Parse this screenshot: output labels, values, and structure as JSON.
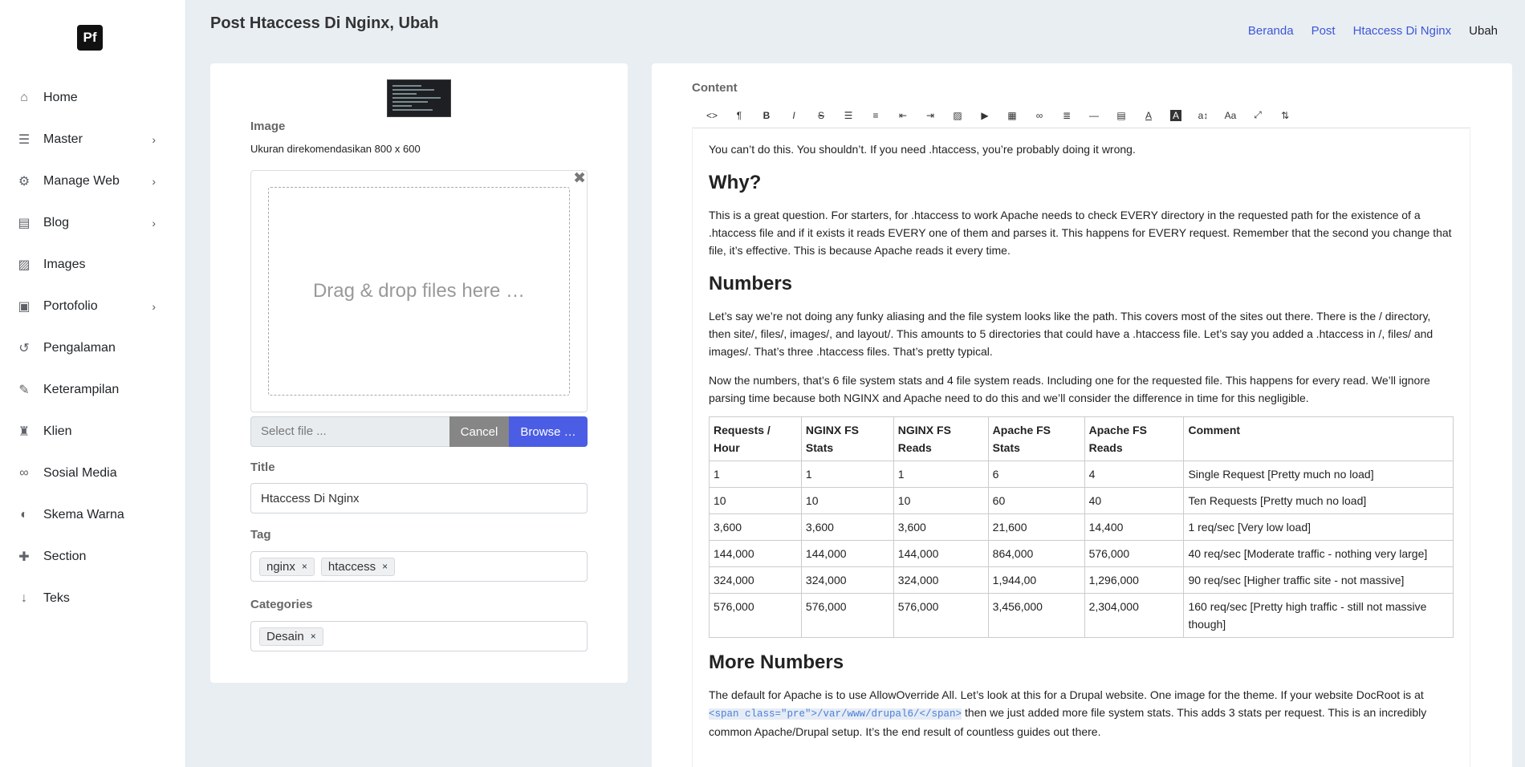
{
  "logo": "Pf",
  "sidebar": {
    "items": [
      {
        "label": "Home",
        "icon": "home-icon",
        "glyph": "⌂",
        "chevron": false
      },
      {
        "label": "Master",
        "icon": "database-icon",
        "glyph": "☰",
        "chevron": true
      },
      {
        "label": "Manage Web",
        "icon": "gears-icon",
        "glyph": "⚙",
        "chevron": true
      },
      {
        "label": "Blog",
        "icon": "newspaper-icon",
        "glyph": "▤",
        "chevron": true
      },
      {
        "label": "Images",
        "icon": "image-icon",
        "glyph": "▨",
        "chevron": false
      },
      {
        "label": "Portofolio",
        "icon": "archive-icon",
        "glyph": "▣",
        "chevron": true
      },
      {
        "label": "Pengalaman",
        "icon": "history-icon",
        "glyph": "↺",
        "chevron": false
      },
      {
        "label": "Keterampilan",
        "icon": "tools-icon",
        "glyph": "✎",
        "chevron": false
      },
      {
        "label": "Klien",
        "icon": "users-icon",
        "glyph": "♜",
        "chevron": false
      },
      {
        "label": "Sosial Media",
        "icon": "link-icon",
        "glyph": "∞",
        "chevron": false
      },
      {
        "label": "Skema Warna",
        "icon": "contrast-icon",
        "glyph": "◐",
        "chevron": false
      },
      {
        "label": "Section",
        "icon": "puzzle-icon",
        "glyph": "✚",
        "chevron": false
      },
      {
        "label": "Teks",
        "icon": "sort-alpha-icon",
        "glyph": "↓",
        "chevron": false
      }
    ],
    "chevron_glyph": "›"
  },
  "header": {
    "title": "Post Htaccess Di Nginx, Ubah",
    "breadcrumbs": [
      "Beranda",
      "Post",
      "Htaccess Di Nginx"
    ],
    "current": "Ubah"
  },
  "form": {
    "image_label": "Image",
    "image_help": "Ukuran direkomendasikan 800 x 600",
    "drop_text": "Drag & drop files here …",
    "close_glyph": "✖",
    "select_placeholder": "Select file ...",
    "cancel_label": "Cancel",
    "browse_label": "Browse …",
    "title_label": "Title",
    "title_value": "Htaccess Di Nginx",
    "tag_label": "Tag",
    "tags": [
      "nginx",
      "htaccess"
    ],
    "categories_label": "Categories",
    "categories": [
      "Desain"
    ],
    "chip_remove": "×"
  },
  "editor": {
    "label": "Content",
    "toolbar": [
      {
        "name": "code-view-icon",
        "glyph": "<>"
      },
      {
        "name": "paragraph-icon",
        "glyph": "¶"
      },
      {
        "name": "bold-icon",
        "glyph": "B"
      },
      {
        "name": "italic-icon",
        "glyph": "I"
      },
      {
        "name": "strikethrough-icon",
        "glyph": "S"
      },
      {
        "name": "unordered-list-icon",
        "glyph": "☰"
      },
      {
        "name": "ordered-list-icon",
        "glyph": "≡"
      },
      {
        "name": "outdent-icon",
        "glyph": "⇤"
      },
      {
        "name": "indent-icon",
        "glyph": "⇥"
      },
      {
        "name": "image-icon",
        "glyph": "▨"
      },
      {
        "name": "video-icon",
        "glyph": "▶"
      },
      {
        "name": "table-icon",
        "glyph": "▦"
      },
      {
        "name": "link-icon",
        "glyph": "∞"
      },
      {
        "name": "align-icon",
        "glyph": "≣"
      },
      {
        "name": "horizontal-rule-icon",
        "glyph": "—"
      },
      {
        "name": "format-block-icon",
        "glyph": "▤"
      },
      {
        "name": "font-color-icon",
        "glyph": "A"
      },
      {
        "name": "background-color-icon",
        "glyph": "A"
      },
      {
        "name": "font-size-icon",
        "glyph": "a↕"
      },
      {
        "name": "font-family-icon",
        "glyph": "Aa"
      },
      {
        "name": "fullscreen-icon",
        "glyph": "⤢"
      },
      {
        "name": "clear-format-icon",
        "glyph": "⇅"
      }
    ],
    "p1": "You can’t do this. You shouldn’t. If you need .htaccess, you’re probably doing it wrong.",
    "h_why": "Why?",
    "p2": "This is a great question. For starters, for .htaccess to work Apache needs to check EVERY directory in the requested path for the existence of a .htaccess file and if it exists it reads EVERY one of them and parses it. This happens for EVERY request. Remember that the second you change that file, it’s effective. This is because Apache reads it every time.",
    "h_numbers": "Numbers",
    "p3": "Let’s say we’re not doing any funky aliasing and the file system looks like the path. This covers most of the sites out there. There is the / directory, then site/, files/, images/, and layout/. This amounts to 5 directories that could have a .htaccess file. Let’s say you added a .htaccess in /, files/ and images/. That’s three .htaccess files. That’s pretty typical.",
    "p4": "Now the numbers, that’s 6 file system stats and 4 file system reads. Including one for the requested file. This happens for every read. We’ll ignore parsing time because both NGINX and Apache need to do this and we’ll consider the difference in time for this negligible.",
    "table": {
      "headers": [
        "Requests / Hour",
        "NGINX FS Stats",
        "NGINX FS Reads",
        "Apache FS Stats",
        "Apache FS Reads",
        "Comment"
      ],
      "rows": [
        [
          "1",
          "1",
          "1",
          "6",
          "4",
          "Single Request [Pretty much no load]"
        ],
        [
          "10",
          "10",
          "10",
          "60",
          "40",
          "Ten Requests [Pretty much no load]"
        ],
        [
          "3,600",
          "3,600",
          "3,600",
          "21,600",
          "14,400",
          "1 req/sec [Very low load]"
        ],
        [
          "144,000",
          "144,000",
          "144,000",
          "864,000",
          "576,000",
          "40 req/sec [Moderate traffic - nothing very large]"
        ],
        [
          "324,000",
          "324,000",
          "324,000",
          "1,944,00",
          "1,296,000",
          "90 req/sec [Higher traffic site - not massive]"
        ],
        [
          "576,000",
          "576,000",
          "576,000",
          "3,456,000",
          "2,304,000",
          "160 req/sec [Pretty high traffic - still not massive though]"
        ]
      ]
    },
    "h_more": "More Numbers",
    "p5_a": "The default for Apache is to use AllowOverride All. Let’s look at this for a Drupal website. One image for the theme. If your website DocRoot is at ",
    "p5_code": "<span class=\"pre\">/var/www/drupal6/</span>",
    "p5_b": " then we just added more file system stats. This adds 3 stats per request. This is an incredibly common Apache/Drupal setup. It’s the end result of countless guides out there."
  }
}
